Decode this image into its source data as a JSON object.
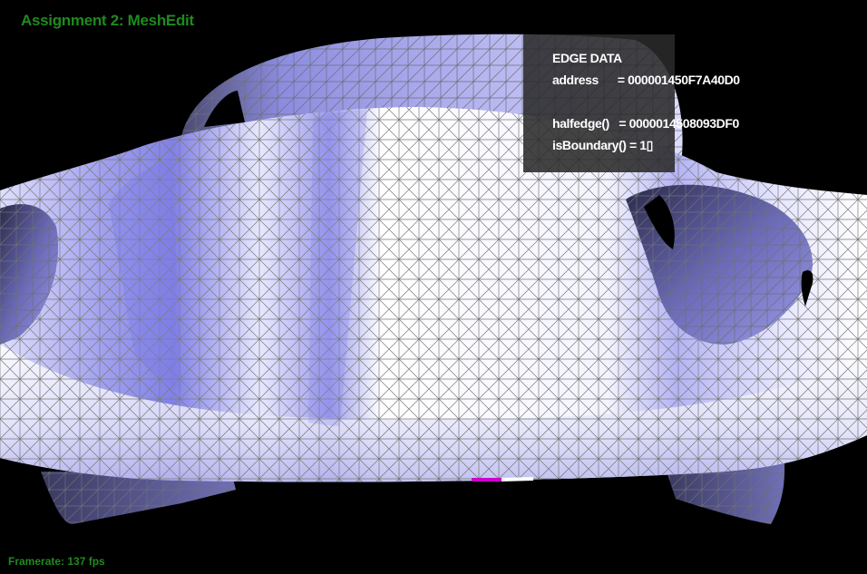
{
  "app": {
    "title": "Assignment 2: MeshEdit",
    "framerate": "Framerate: 137 fps"
  },
  "edge_panel": {
    "heading": "EDGE DATA",
    "address_line": "address      = 000001450F7A40D0",
    "halfedge_line": "halfedge()   = 0000014508093DF0",
    "boundary_line": "isBoundary() = 1▯"
  },
  "colors": {
    "accent_green": "#1f8a1f",
    "background": "#000000",
    "mesh_light": "#f2f2ff",
    "mesh_shadow": "#8a8ae6",
    "wire": "#777777",
    "selected_edge": "#cc00cc"
  }
}
